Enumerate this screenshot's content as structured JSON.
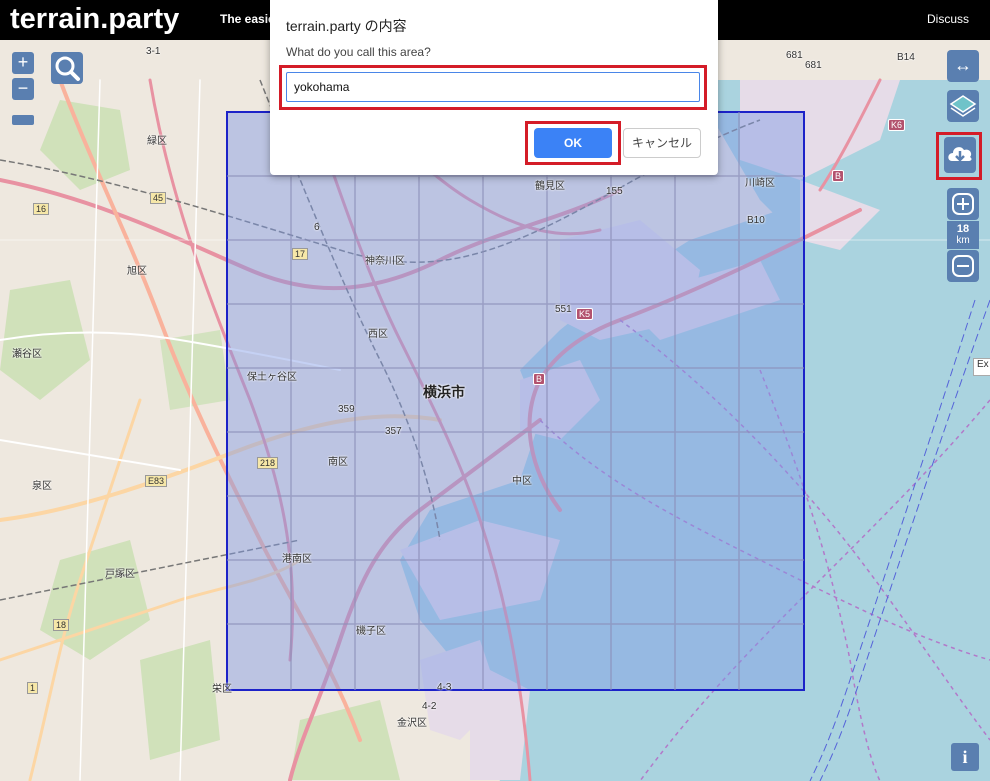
{
  "header": {
    "logo": "terrain.party",
    "tagline": "The easiest way to get real-world height maps",
    "discuss": "Discuss"
  },
  "controls": {
    "zoom_in": "+",
    "zoom_out": "−",
    "scale_value": "18",
    "scale_unit": "km",
    "info": "i",
    "right_top": "↔",
    "ex_tooltip": "Ex"
  },
  "dialog": {
    "title": "terrain.party の内容",
    "prompt": "What do you call this area?",
    "input_value": "yokohama",
    "ok_label": "OK",
    "cancel_label": "キャンセル"
  },
  "map_labels": {
    "midori": "緑区",
    "asahi": "旭区",
    "seya": "瀬谷区",
    "izumi": "泉区",
    "totsuka": "戸塚区",
    "sakae": "栄区",
    "kanagawa": "神奈川区",
    "nishi": "西区",
    "hodogaya": "保土ヶ谷区",
    "yokohama": "横浜市",
    "minami": "南区",
    "naka": "中区",
    "konan": "港南区",
    "isogo": "磯子区",
    "kanazawa": "金沢区",
    "tsurumi": "鶴見区",
    "kawasaki": "川崎区"
  },
  "road_labels": {
    "r3_1": "3-1",
    "r45": "45",
    "r16": "16",
    "r17": "17",
    "r6": "6",
    "r218": "218",
    "rE83": "E83",
    "r18": "18",
    "r1": "1",
    "r155": "155",
    "rB10": "B10",
    "rB14": "B14",
    "r681a": "681",
    "r681b": "681",
    "rK6": "K6",
    "rB": "B",
    "rK5": "K5",
    "rB2": "B",
    "r359": "359",
    "r357": "357",
    "r4_2": "4-2",
    "r4_3": "4-3",
    "r551": "551"
  },
  "colors": {
    "accent": "#5a7fb0",
    "highlight": "#d41c28",
    "selection_fill": "#7f98e6",
    "selection_stroke": "#1c22c8",
    "sea": "#aad3df",
    "ok_button": "#3b82f6"
  }
}
